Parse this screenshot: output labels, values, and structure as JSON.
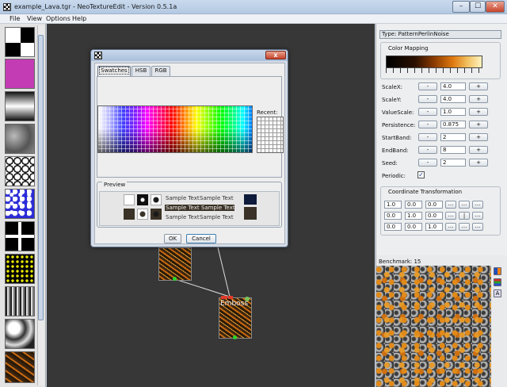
{
  "window": {
    "title": "example_Lava.tgr - NeoTextureEdit - Version 0.5.1a",
    "minimize": "–",
    "maximize": "☐",
    "close": "✕"
  },
  "menu": [
    "File",
    "View",
    "Options",
    "Help"
  ],
  "palette": {
    "thumbnails": [
      "checker",
      "magenta",
      "gradient",
      "clouds",
      "cells",
      "blue-noise",
      "grid",
      "dots",
      "stripes",
      "marble",
      "lava"
    ]
  },
  "properties": {
    "type_label": "Type: PatternPerlinNoise",
    "color_mapping_title": "Color Mapping",
    "params": [
      {
        "label": "ScaleX:",
        "value": "4.0"
      },
      {
        "label": "ScaleY:",
        "value": "4.0"
      },
      {
        "label": "ValueScale:",
        "value": "1.0"
      },
      {
        "label": "Persistence:",
        "value": "0.875"
      },
      {
        "label": "StartBand:",
        "value": "2"
      },
      {
        "label": "EndBand:",
        "value": "8"
      },
      {
        "label": "Seed:",
        "value": "2"
      }
    ],
    "minus": "-",
    "plus": "+",
    "periodic_label": "Periodic:",
    "periodic_checked": true,
    "coord_title": "Coordinate Transformation",
    "coords": [
      [
        "1.0",
        "0.0",
        "0.0"
      ],
      [
        "0.0",
        "1.0",
        "0.0"
      ],
      [
        "0.0",
        "0.0",
        "1.0"
      ]
    ],
    "coord_btns": [
      "...",
      "...",
      "...",
      "...",
      "|",
      "...",
      "...",
      "...",
      "..."
    ]
  },
  "benchmark": "Benchmark: 15",
  "nodes": {
    "emboss_label": "Emboss"
  },
  "color_dialog": {
    "close": "x",
    "tabs": [
      "Swatches",
      "HSB",
      "RGB"
    ],
    "recent_label": "Recent:",
    "preview_label": "Preview",
    "sample_text": "Sample Text",
    "ok": "OK",
    "cancel": "Cancel"
  },
  "colors": {
    "canvas": "#373737",
    "preview_color": "#0f1b3a",
    "preview_color_dark": "#3a3226"
  }
}
